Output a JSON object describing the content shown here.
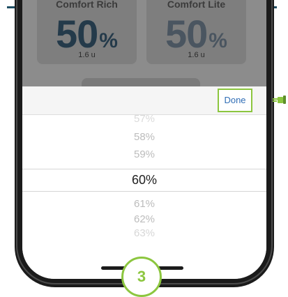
{
  "cards": [
    {
      "header": "Comfort Rich",
      "value": "50",
      "unit_symbol": "%",
      "units_text": "1.6 u"
    },
    {
      "header": "Comfort Lite",
      "value": "50",
      "unit_symbol": "%",
      "units_text": "1.6 u"
    }
  ],
  "toolbar": {
    "done_label": "Done"
  },
  "picker": {
    "items": [
      "57%",
      "58%",
      "59%",
      "60%",
      "61%",
      "62%",
      "63%"
    ],
    "selected": "60%"
  },
  "step": {
    "number": "3"
  },
  "colors": {
    "accent_green": "#8cc63f",
    "done_text": "#2f6db5",
    "frame": "#1b1b1b",
    "top_line": "#1f4e63"
  },
  "icons": {
    "pointer": "pointing-hand-icon"
  }
}
